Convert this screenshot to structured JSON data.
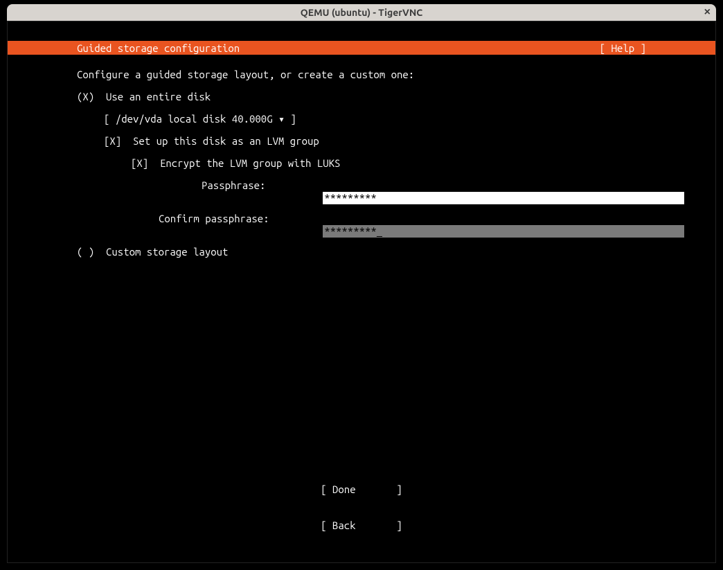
{
  "window": {
    "title": "QEMU (ubuntu) - TigerVNC"
  },
  "header": {
    "title": "Guided storage configuration",
    "help": "[ Help ]"
  },
  "body": {
    "intro": "Configure a guided storage layout, or create a custom one:",
    "opt_entire_disk": "(X)  Use an entire disk",
    "disk_selector": "[ /dev/vda local disk 40.000G ▾ ]",
    "opt_lvm": "[X]  Set up this disk as an LVM group",
    "opt_encrypt": "[X]  Encrypt the LVM group with LUKS",
    "passphrase_label": "Passphrase:",
    "passphrase_value": "*********",
    "confirm_label": "Confirm passphrase:",
    "confirm_value": "*********_",
    "opt_custom": "( )  Custom storage layout"
  },
  "footer": {
    "done": "[ Done       ]",
    "back": "[ Back       ]"
  }
}
